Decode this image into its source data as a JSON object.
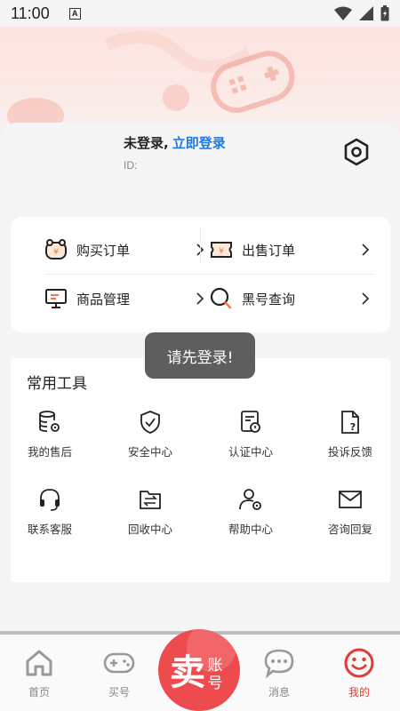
{
  "status_bar": {
    "time": "11:00",
    "badge": "A"
  },
  "profile": {
    "not_logged_in": "未登录,",
    "login_link": "立即登录",
    "id_label": "ID:"
  },
  "orders": [
    {
      "label": "购买订单",
      "icon": "wallet-pig-icon"
    },
    {
      "label": "出售订单",
      "icon": "ticket-yen-icon"
    },
    {
      "label": "商品管理",
      "icon": "monitor-icon"
    },
    {
      "label": "黑号查询",
      "icon": "search-icon"
    }
  ],
  "toast": "请先登录!",
  "tools": {
    "title": "常用工具",
    "items": [
      {
        "label": "我的售后",
        "icon": "database-gear-icon"
      },
      {
        "label": "安全中心",
        "icon": "shield-check-icon"
      },
      {
        "label": "认证中心",
        "icon": "certificate-icon"
      },
      {
        "label": "投诉反馈",
        "icon": "document-question-icon"
      },
      {
        "label": "联系客服",
        "icon": "headset-icon"
      },
      {
        "label": "回收中心",
        "icon": "folder-exchange-icon"
      },
      {
        "label": "帮助中心",
        "icon": "user-gear-icon"
      },
      {
        "label": "咨询回复",
        "icon": "mail-icon"
      }
    ]
  },
  "tabbar": {
    "home": "首页",
    "buy": "买号",
    "sell_main": "卖",
    "sell_sub1": "账",
    "sell_sub2": "号",
    "messages": "消息",
    "mine": "我的"
  },
  "colors": {
    "accent": "#e53935",
    "link": "#1e7be6",
    "sell_button": "#ee4b4f"
  }
}
